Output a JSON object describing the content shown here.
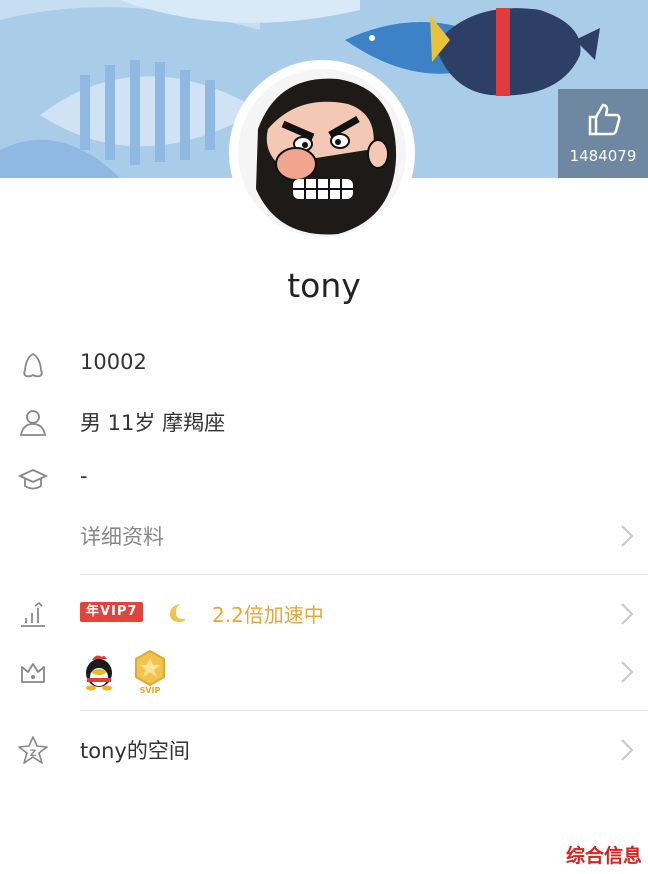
{
  "profile": {
    "nickname": "tony",
    "like_count": "1484079"
  },
  "info": {
    "qq_number": "10002",
    "basic": "男 11岁 摩羯座",
    "education": "-",
    "details_link": "详细资料"
  },
  "vip": {
    "badge": "年VIP7",
    "speed": "2.2倍加速中"
  },
  "honors": {
    "medal_text": "SVIP"
  },
  "space": {
    "label": "tony的空间"
  },
  "watermark": "综合信息",
  "icons": [
    "qq-penguin-icon",
    "person-icon",
    "graduation-cap-icon",
    "growth-chart-icon",
    "moon-icon",
    "crown-icon",
    "penguin-mascot-icon",
    "medal-icon",
    "space-star-icon",
    "thumbs-up-icon",
    "chevron-right-icon"
  ],
  "colors": {
    "vip_red": "#e0443a",
    "speed_orange": "#e8a53a",
    "header_blue": "#a9cde9",
    "watermark_red": "#d8231f"
  }
}
